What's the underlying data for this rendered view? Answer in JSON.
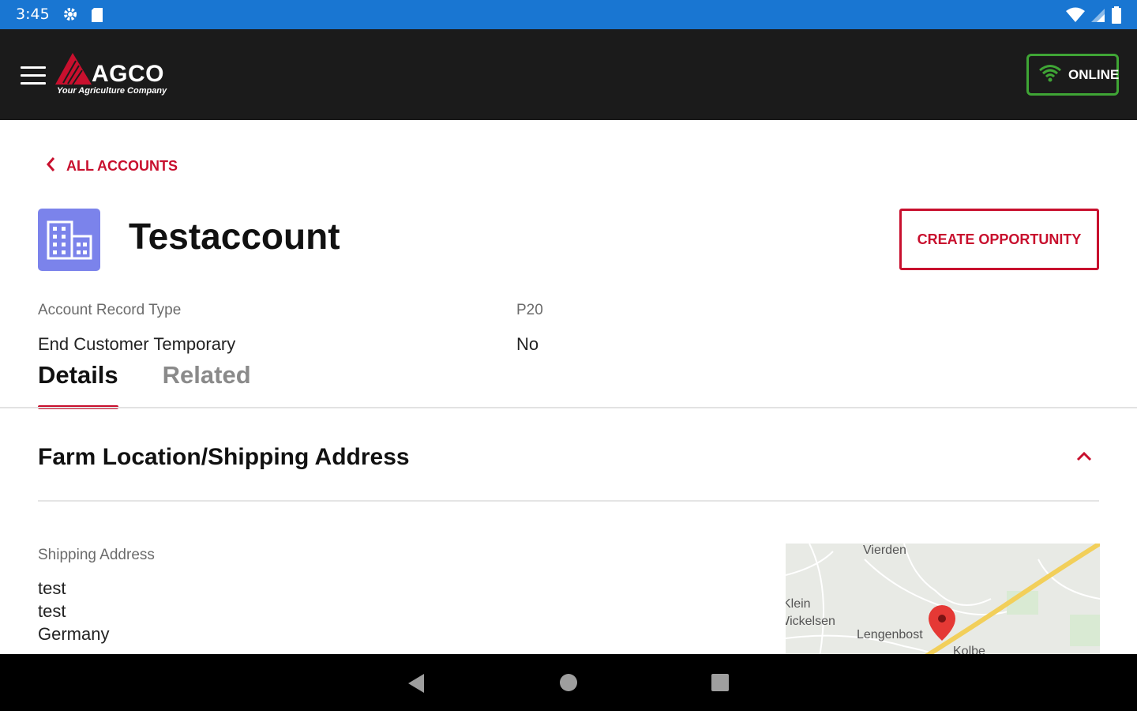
{
  "status_bar": {
    "time": "3:45",
    "icons": [
      "gear-icon",
      "sd-card-icon",
      "wifi-icon",
      "signal-icon",
      "battery-icon"
    ]
  },
  "app_bar": {
    "brand": "AGCO",
    "tagline": "Your Agriculture Company",
    "online_label": "ONLINE"
  },
  "nav": {
    "back_label": "ALL ACCOUNTS"
  },
  "account": {
    "name": "Testaccount",
    "create_opportunity_label": "CREATE OPPORTUNITY",
    "fields": [
      {
        "label": "Account Record Type",
        "value": "P20"
      },
      {
        "label": "End Customer Temporary",
        "value": "No"
      }
    ]
  },
  "tabs": [
    {
      "label": "Details",
      "active": true
    },
    {
      "label": "Related",
      "active": false
    }
  ],
  "section": {
    "title": "Farm Location/Shipping Address"
  },
  "shipping": {
    "label": "Shipping Address",
    "lines": [
      "test",
      "test",
      "Germany"
    ]
  },
  "map": {
    "places": [
      "Vierden",
      "Klein",
      "Wickelsen",
      "Lengenbost",
      "Kolbe"
    ]
  },
  "colors": {
    "accent": "#c8102e",
    "status_bar": "#1976d2",
    "app_bar": "#1b1b1b",
    "online_green": "#3fa535",
    "account_icon": "#7b83eb"
  }
}
